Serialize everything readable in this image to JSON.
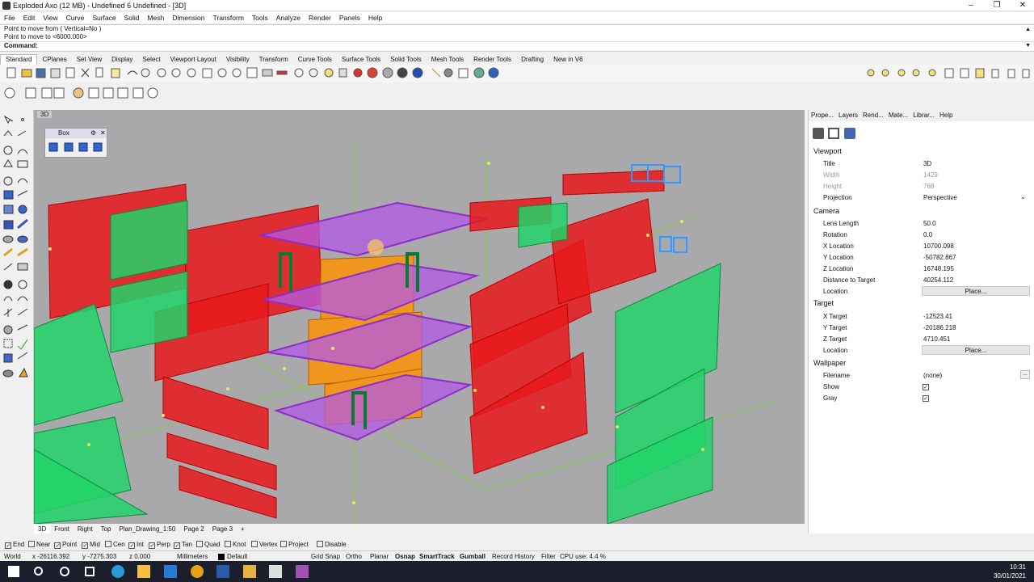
{
  "window": {
    "title": "Exploded Axo (12 MB) - Undefined 6 Undefined - [3D]"
  },
  "menu": [
    "File",
    "Edit",
    "View",
    "Curve",
    "Surface",
    "Solid",
    "Mesh",
    "Dimension",
    "Transform",
    "Tools",
    "Analyze",
    "Render",
    "Panels",
    "Help"
  ],
  "command": {
    "line1": "Point to move from ( Vertical=No )",
    "line2": "Point to move to <6000.000>",
    "prompt": "Command:"
  },
  "toolbar_tabs": [
    "Standard",
    "CPlanes",
    "Set View",
    "Display",
    "Select",
    "Viewport Layout",
    "Visibility",
    "Transform",
    "Curve Tools",
    "Surface Tools",
    "Solid Tools",
    "Mesh Tools",
    "Render Tools",
    "Drafting",
    "New in V6"
  ],
  "viewport": {
    "label": "3D"
  },
  "box_panel": {
    "title": "Box"
  },
  "right_tabs": [
    "Prope...",
    "Layers",
    "Rend...",
    "Mate...",
    "Librar...",
    "Help"
  ],
  "properties": {
    "viewport_section": "Viewport",
    "title_label": "Title",
    "title_value": "3D",
    "width_label": "Width",
    "width_value": "1429",
    "height_label": "Height",
    "height_value": "768",
    "projection_label": "Projection",
    "projection_value": "Perspective",
    "camera_section": "Camera",
    "lens_label": "Lens Length",
    "lens_value": "50.0",
    "rotation_label": "Rotation",
    "rotation_value": "0.0",
    "xloc_label": "X Location",
    "xloc_value": "10700.098",
    "yloc_label": "Y Location",
    "yloc_value": "-50782.867",
    "zloc_label": "Z Location",
    "zloc_value": "16748.195",
    "dist_label": "Distance to Target",
    "dist_value": "40254.112",
    "location_label": "Location",
    "place_label": "Place...",
    "target_section": "Target",
    "xt_label": "X Target",
    "xt_value": "-12523.41",
    "yt_label": "Y Target",
    "yt_value": "-20186.218",
    "zt_label": "Z Target",
    "zt_value": "4710.451",
    "tloc_label": "Location",
    "tplace_label": "Place...",
    "wallpaper_section": "Wallpaper",
    "filename_label": "Filename",
    "filename_value": "(none)",
    "show_label": "Show",
    "gray_label": "Gray"
  },
  "view_tabs": [
    "3D",
    "Front",
    "Right",
    "Top",
    "Plan_Drawing_1:50",
    "Page 2",
    "Page 3"
  ],
  "osnaps": [
    {
      "label": "End",
      "checked": true
    },
    {
      "label": "Near",
      "checked": false
    },
    {
      "label": "Point",
      "checked": true
    },
    {
      "label": "Mid",
      "checked": true
    },
    {
      "label": "Cen",
      "checked": false
    },
    {
      "label": "Int",
      "checked": true
    },
    {
      "label": "Perp",
      "checked": true
    },
    {
      "label": "Tan",
      "checked": true
    },
    {
      "label": "Quad",
      "checked": false
    },
    {
      "label": "Knot",
      "checked": false
    },
    {
      "label": "Vertex",
      "checked": false
    },
    {
      "label": "Project",
      "checked": false
    },
    {
      "label": "Disable",
      "checked": false
    }
  ],
  "status": {
    "cplane": "World",
    "x": "x -26116.392",
    "y": "y -7275.303",
    "z": "z 0.000",
    "units": "Millimeters",
    "layer": "Default",
    "items": [
      "Grid Snap",
      "Ortho",
      "Planar",
      "Osnap",
      "SmartTrack",
      "Gumball",
      "Record History",
      "Filter",
      "CPU use: 4.4 %"
    ]
  },
  "clock": {
    "time": "10:31",
    "date": "30/01/2021"
  },
  "colors": {
    "red": "#e8191c",
    "green": "#22d36a",
    "purple": "#b45ae6",
    "orange": "#f0961e",
    "blue": "#3399ff",
    "viewport_bg": "#a9a9ab"
  }
}
